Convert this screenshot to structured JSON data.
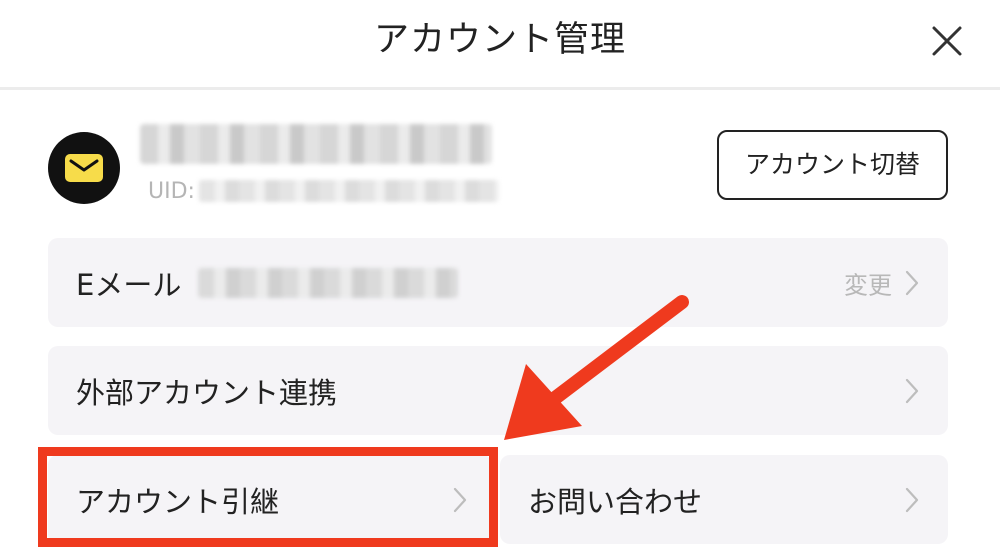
{
  "header": {
    "title": "アカウント管理",
    "close_icon": "close-icon"
  },
  "account": {
    "avatar_icon": "mail-envelope-icon",
    "uid_label": "UID:",
    "switch_button_label": "アカウント切替"
  },
  "items": {
    "email": {
      "label": "Eメール",
      "action": "変更"
    },
    "external": {
      "label": "外部アカウント連携"
    },
    "transfer": {
      "label": "アカウント引継"
    },
    "contact": {
      "label": "お問い合わせ"
    }
  },
  "annotation": {
    "highlight_color": "#ef3a1e"
  },
  "colors": {
    "card_bg": "#f5f4f7",
    "avatar_bg": "#111111",
    "avatar_icon": "#f7dc4a",
    "muted_text": "#b8b8b8"
  }
}
